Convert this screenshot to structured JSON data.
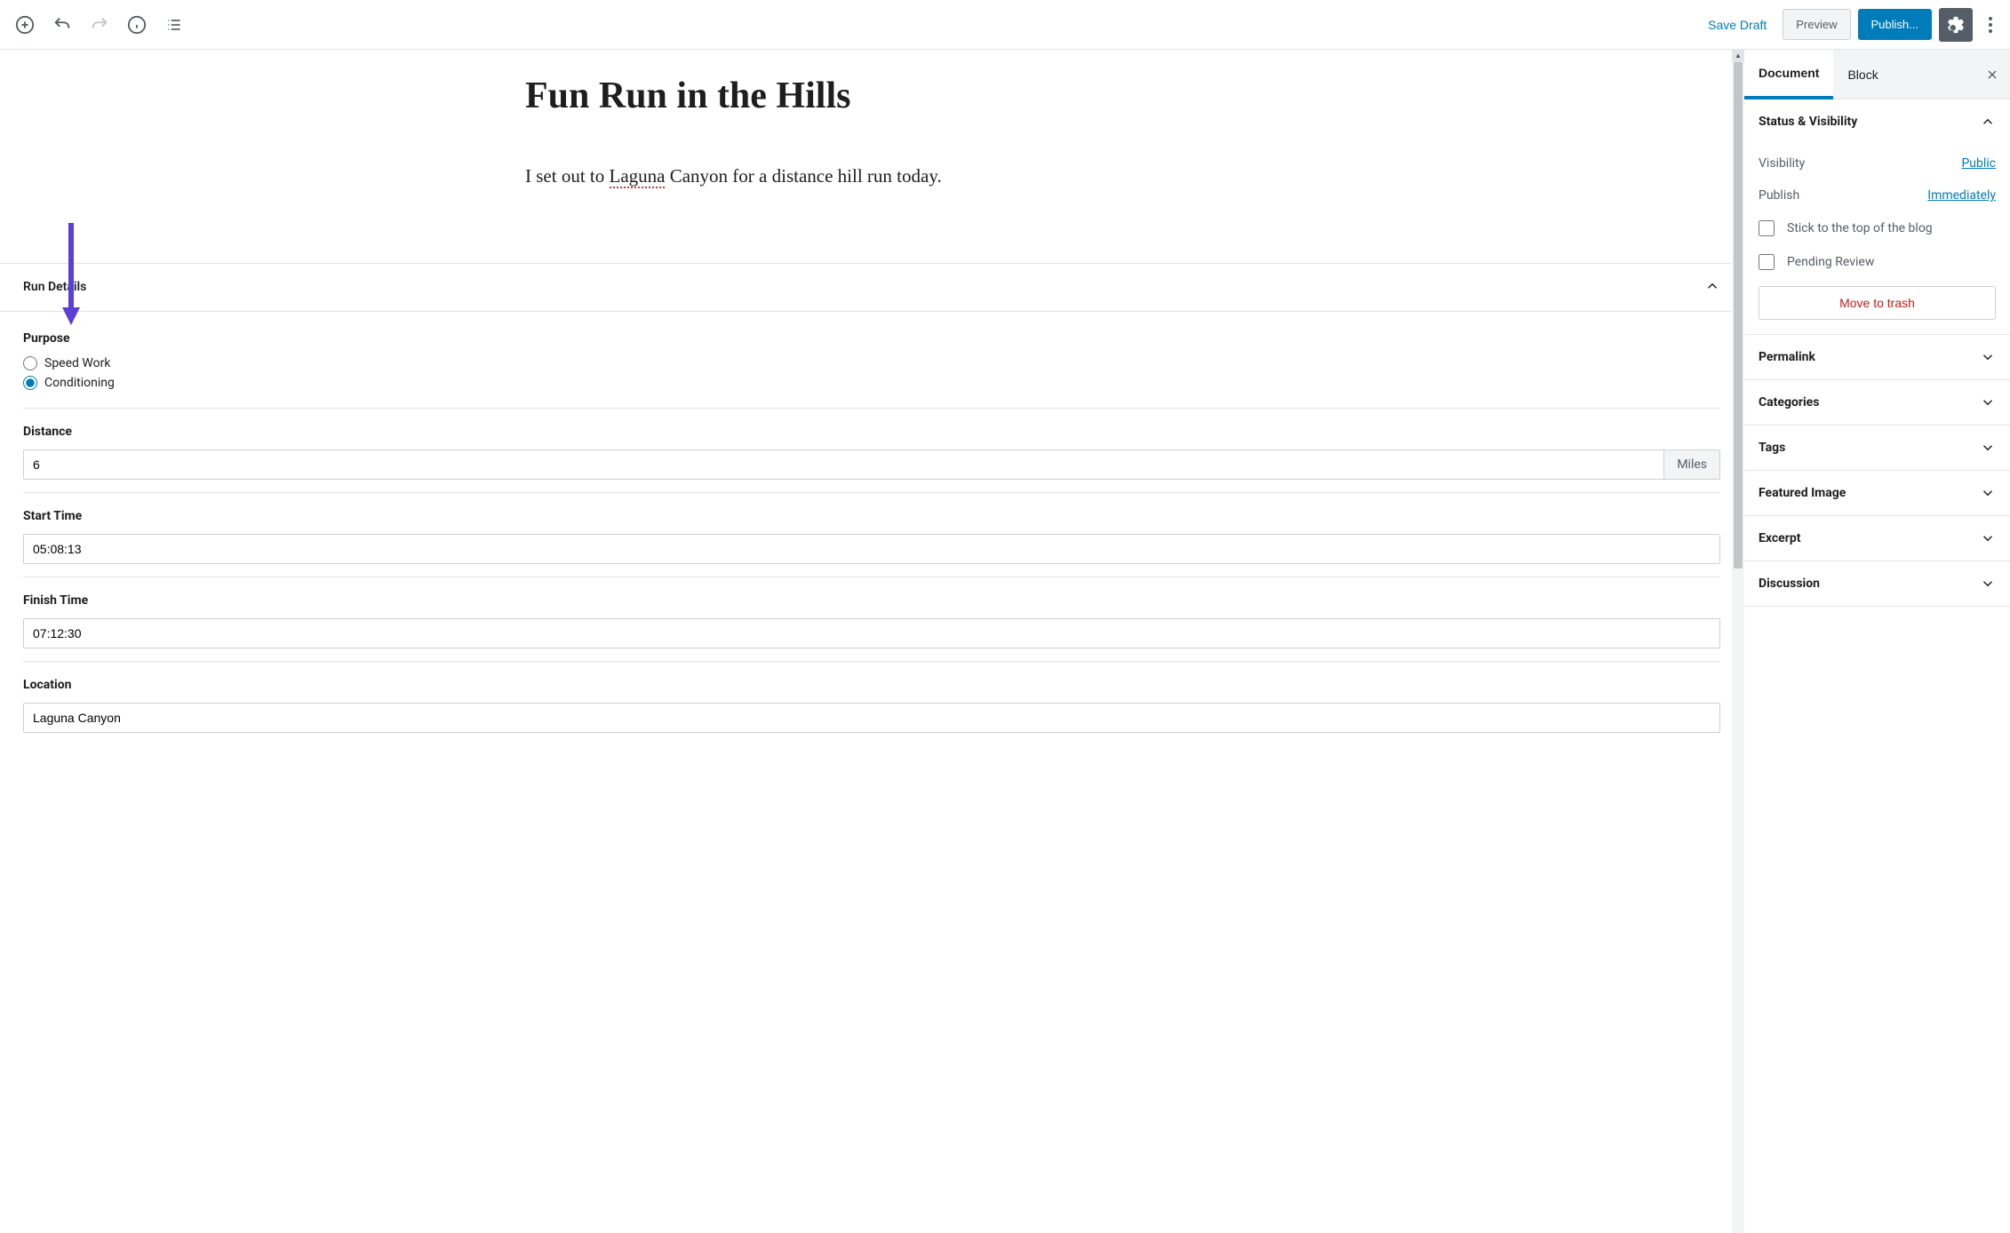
{
  "toolbar": {
    "save_draft": "Save Draft",
    "preview": "Preview",
    "publish": "Publish..."
  },
  "post": {
    "title": "Fun Run in the Hills",
    "body_pre": "I set out to ",
    "body_spell": "Laguna",
    "body_post": " Canyon for a distance hill run today."
  },
  "metabox": {
    "title": "Run Details",
    "purpose": {
      "label": "Purpose",
      "options": [
        "Speed Work",
        "Conditioning"
      ],
      "selected": "Conditioning"
    },
    "distance": {
      "label": "Distance",
      "value": "6",
      "unit": "Miles"
    },
    "start": {
      "label": "Start Time",
      "value": "05:08:13"
    },
    "finish": {
      "label": "Finish Time",
      "value": "07:12:30"
    },
    "location": {
      "label": "Location",
      "value": "Laguna Canyon"
    }
  },
  "sidebar": {
    "tabs": {
      "document": "Document",
      "block": "Block"
    },
    "status": {
      "title": "Status & Visibility",
      "visibility_label": "Visibility",
      "visibility_value": "Public",
      "publish_label": "Publish",
      "publish_value": "Immediately",
      "stick": "Stick to the top of the blog",
      "pending": "Pending Review",
      "trash": "Move to trash"
    },
    "panels": [
      "Permalink",
      "Categories",
      "Tags",
      "Featured Image",
      "Excerpt",
      "Discussion"
    ]
  }
}
